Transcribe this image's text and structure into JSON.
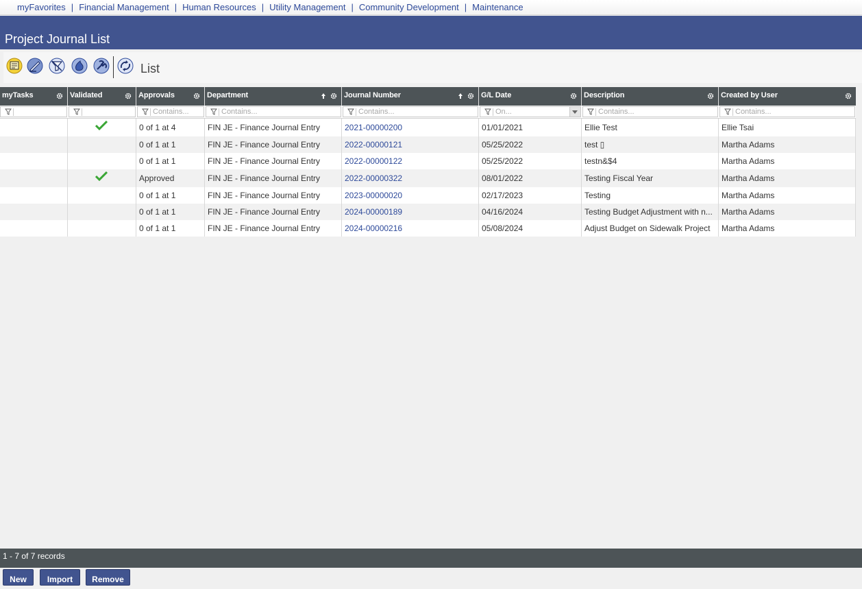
{
  "nav": {
    "items": [
      "myFavorites",
      "Financial Management",
      "Human Resources",
      "Utility Management",
      "Community Development",
      "Maintenance"
    ],
    "separator": "|"
  },
  "page": {
    "title": "Project Journal List"
  },
  "toolbar": {
    "buttons": [
      "notes-icon",
      "edit-icon",
      "filter-clear-icon",
      "add-icon",
      "tools-icon",
      "refresh-icon"
    ],
    "view_label": "List"
  },
  "grid": {
    "columns": [
      {
        "label": "myTasks",
        "filter_placeholder": ""
      },
      {
        "label": "Validated",
        "filter_placeholder": ""
      },
      {
        "label": "Approvals",
        "filter_placeholder": "Contains..."
      },
      {
        "label": "Department",
        "filter_placeholder": "Contains..."
      },
      {
        "label": "Journal Number",
        "filter_placeholder": "Contains..."
      },
      {
        "label": "G/L Date",
        "filter_placeholder": "On..."
      },
      {
        "label": "Description",
        "filter_placeholder": "Contains..."
      },
      {
        "label": "Created by User",
        "filter_placeholder": "Contains..."
      }
    ],
    "rows": [
      {
        "validated": true,
        "approvals": "0 of 1 at 4",
        "department": "FIN JE - Finance Journal Entry",
        "journal_number": "2021-00000200",
        "gl_date": "01/01/2021",
        "description": "Ellie Test",
        "created_by": "Ellie Tsai"
      },
      {
        "validated": false,
        "approvals": "0 of 1 at 1",
        "department": "FIN JE - Finance Journal Entry",
        "journal_number": "2022-00000121",
        "gl_date": "05/25/2022",
        "description": "test ▯",
        "created_by": "Martha Adams"
      },
      {
        "validated": false,
        "approvals": "0 of 1 at 1",
        "department": "FIN JE - Finance Journal Entry",
        "journal_number": "2022-00000122",
        "gl_date": "05/25/2022",
        "description": "testn&$4",
        "created_by": "Martha Adams"
      },
      {
        "validated": true,
        "approvals": "Approved",
        "department": "FIN JE - Finance Journal Entry",
        "journal_number": "2022-00000322",
        "gl_date": "08/01/2022",
        "description": "Testing Fiscal Year",
        "created_by": "Martha Adams"
      },
      {
        "validated": false,
        "approvals": "0 of 1 at 1",
        "department": "FIN JE - Finance Journal Entry",
        "journal_number": "2023-00000020",
        "gl_date": "02/17/2023",
        "description": "Testing",
        "created_by": "Martha Adams"
      },
      {
        "validated": false,
        "approvals": "0 of 1 at 1",
        "department": "FIN JE - Finance Journal Entry",
        "journal_number": "2024-00000189",
        "gl_date": "04/16/2024",
        "description": "Testing Budget Adjustment with n...",
        "created_by": "Martha Adams"
      },
      {
        "validated": false,
        "approvals": "0 of 1 at 1",
        "department": "FIN JE - Finance Journal Entry",
        "journal_number": "2024-00000216",
        "gl_date": "05/08/2024",
        "description": "Adjust Budget on Sidewalk Project",
        "created_by": "Martha Adams"
      }
    ]
  },
  "status": {
    "records_text": "1 - 7 of 7 records"
  },
  "actions": {
    "new_label": "New",
    "import_label": "Import",
    "remove_label": "Remove"
  },
  "colors": {
    "title_bar": "#41548f",
    "header": "#4d5457",
    "link": "#2e4a9a",
    "check": "#3aa635"
  }
}
